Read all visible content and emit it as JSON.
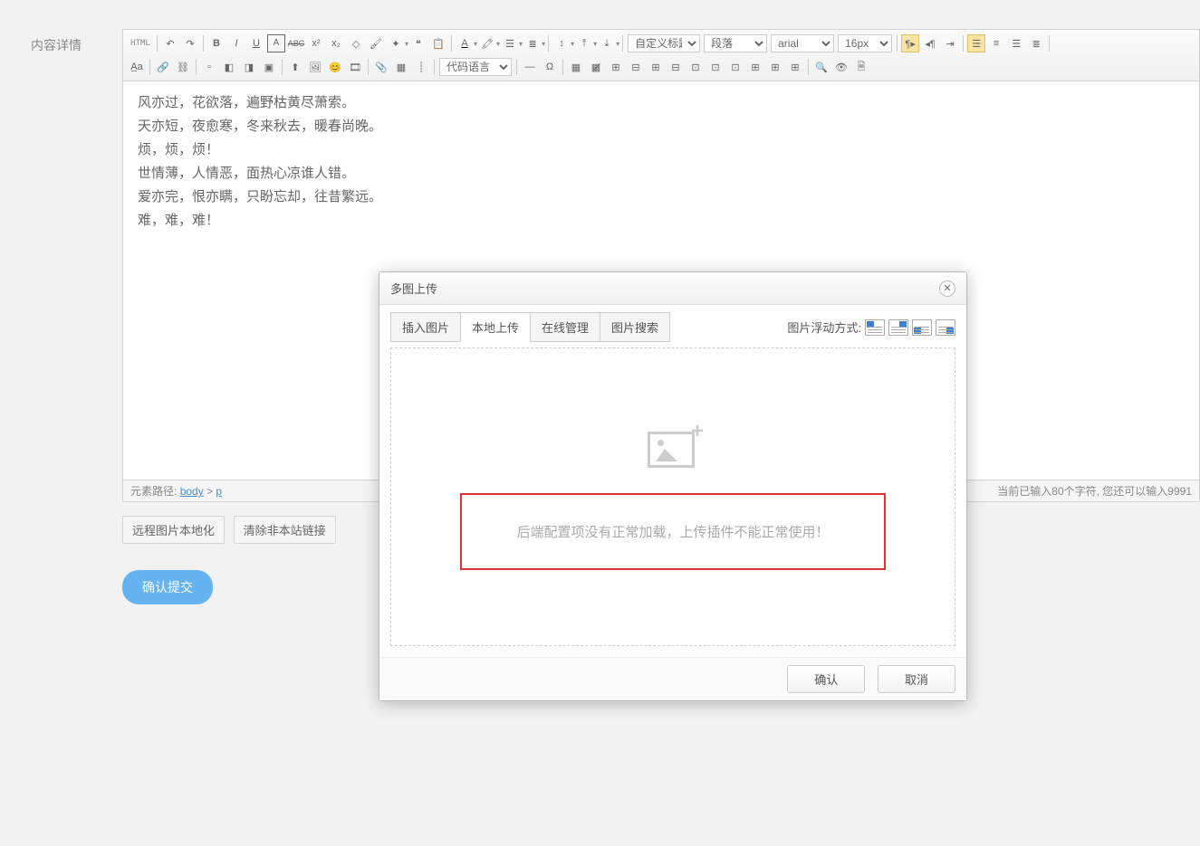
{
  "page": {
    "label": "内容详情"
  },
  "toolbar": {
    "html": "HTML",
    "heading_select": "自定义标题",
    "para_select": "段落",
    "font_select": "arial",
    "size_select": "16px",
    "code_lang": "代码语言"
  },
  "content": {
    "lines": [
      "风亦过，花欲落，遍野枯黄尽萧索。",
      "天亦短，夜愈寒，冬来秋去，暖春尚晚。",
      "烦，烦，烦！",
      "世情薄，人情恶，面热心凉谁人错。",
      "爱亦完，恨亦瞒，只盼忘却，往昔繁远。",
      "难，难，难！"
    ]
  },
  "status": {
    "path_label": "元素路径:",
    "path_body": "body",
    "path_sep": ">",
    "path_p": "p",
    "count_text": "当前已输入80个字符, 您还可以输入9991"
  },
  "buttons": {
    "localize": "远程图片本地化",
    "clear_links": "清除非本站链接",
    "submit": "确认提交"
  },
  "dialog": {
    "title": "多图上传",
    "tabs": [
      "插入图片",
      "本地上传",
      "在线管理",
      "图片搜索"
    ],
    "float_label": "图片浮动方式:",
    "error": "后端配置项没有正常加载，上传插件不能正常使用！",
    "ok": "确认",
    "cancel": "取消"
  }
}
